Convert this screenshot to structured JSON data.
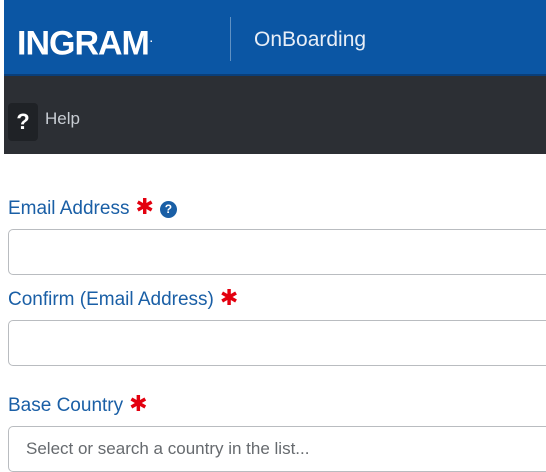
{
  "header": {
    "logo_text": "INGRAM",
    "logo_mark": ".",
    "app_title": "OnBoarding"
  },
  "subbar": {
    "help_icon": "?",
    "help_label": "Help"
  },
  "form": {
    "email": {
      "label": "Email Address",
      "required_mark": "✱",
      "info_icon": "?",
      "value": ""
    },
    "confirm_email": {
      "label": "Confirm (Email Address)",
      "required_mark": "✱",
      "value": ""
    },
    "base_country": {
      "label": "Base Country",
      "required_mark": "✱",
      "placeholder": "Select or search a country in the list..."
    }
  },
  "colors": {
    "header_bg": "#0b56a4",
    "subbar_bg": "#2c2f34",
    "label": "#1a5fa6",
    "required": "#e3000f"
  }
}
